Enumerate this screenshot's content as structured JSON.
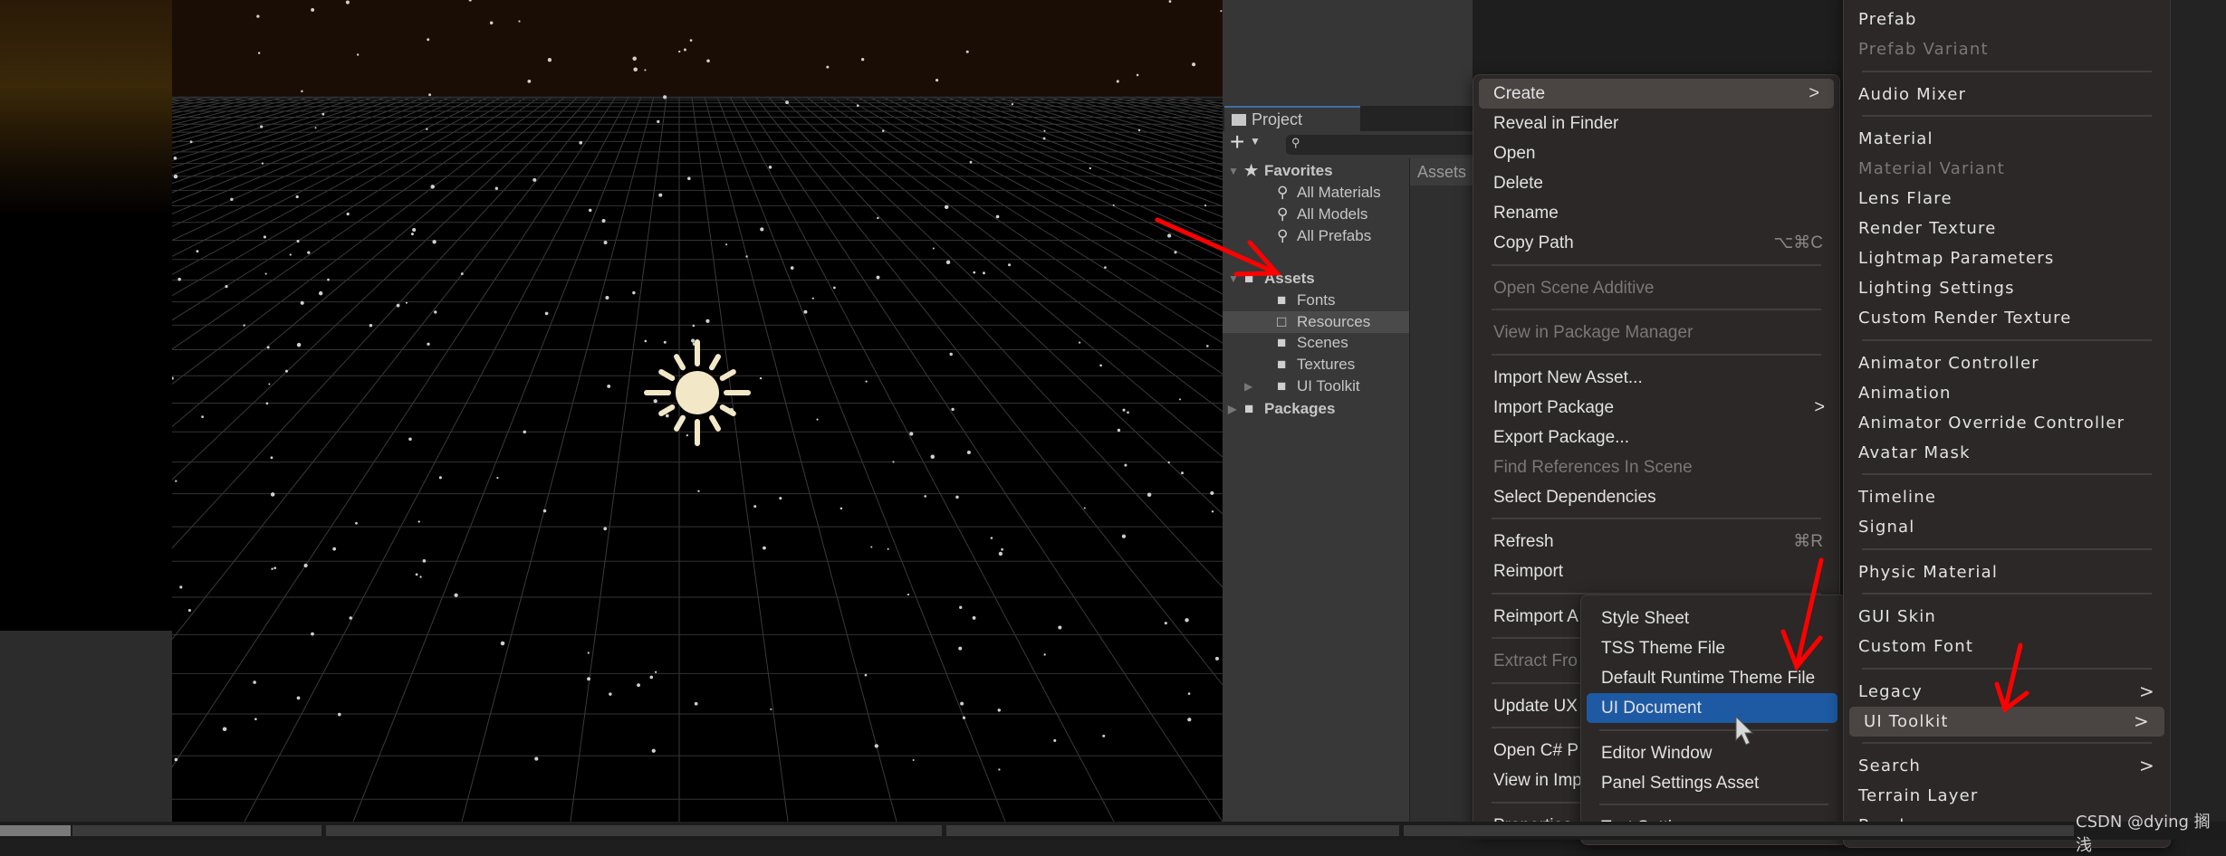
{
  "project_panel": {
    "tab_label": "Project",
    "add_button": "+",
    "assets_header": "Assets",
    "tree": [
      {
        "label": "Favorites",
        "icon": "star-icon",
        "level": 0,
        "bold": true,
        "expanded": true
      },
      {
        "label": "All Materials",
        "icon": "search-icon",
        "level": 1
      },
      {
        "label": "All Models",
        "icon": "search-icon",
        "level": 1
      },
      {
        "label": "All Prefabs",
        "icon": "search-icon",
        "level": 1
      },
      {
        "label": "Assets",
        "icon": "folder-open-icon",
        "level": 0,
        "bold": true,
        "expanded": true
      },
      {
        "label": "Fonts",
        "icon": "folder-icon",
        "level": 1
      },
      {
        "label": "Resources",
        "icon": "folder-outline-icon",
        "level": 1,
        "selected": true
      },
      {
        "label": "Scenes",
        "icon": "folder-icon",
        "level": 1
      },
      {
        "label": "Textures",
        "icon": "folder-icon",
        "level": 1
      },
      {
        "label": "UI Toolkit",
        "icon": "folder-icon",
        "level": 1,
        "collapsed": true
      },
      {
        "label": "Packages",
        "icon": "folder-icon",
        "level": 0,
        "bold": true,
        "collapsed": true
      }
    ]
  },
  "context_menu": {
    "items": [
      {
        "label": "Create",
        "submenu": true,
        "highlighted": true,
        "row": 0
      },
      {
        "label": "Reveal in Finder",
        "row": 1
      },
      {
        "label": "Open",
        "row": 2
      },
      {
        "label": "Delete",
        "row": 3
      },
      {
        "label": "Rename",
        "row": 4
      },
      {
        "label": "Copy Path",
        "shortcut": "⌥⌘C",
        "row": 5
      },
      {
        "sep": true,
        "row": 5.75
      },
      {
        "label": "Open Scene Additive",
        "disabled": true,
        "row": 6.5
      },
      {
        "sep": true,
        "row": 7.25
      },
      {
        "label": "View in Package Manager",
        "disabled": true,
        "row": 8
      },
      {
        "sep": true,
        "row": 8.75
      },
      {
        "label": "Import New Asset...",
        "row": 9.5
      },
      {
        "label": "Import Package",
        "submenu": true,
        "row": 10.5
      },
      {
        "label": "Export Package...",
        "row": 11.5
      },
      {
        "label": "Find References In Scene",
        "disabled": true,
        "row": 12.5
      },
      {
        "label": "Select Dependencies",
        "row": 13.5
      },
      {
        "sep": true,
        "row": 14.25
      },
      {
        "label": "Refresh",
        "shortcut": "⌘R",
        "row": 15
      },
      {
        "label": "Reimport",
        "row": 16
      },
      {
        "sep": true,
        "row": 16.75
      },
      {
        "label": "Reimport A",
        "row": 17.5
      },
      {
        "sep": true,
        "row": 18.25
      },
      {
        "label": "Extract Fro",
        "disabled": true,
        "row": 19
      },
      {
        "sep": true,
        "row": 19.75
      },
      {
        "label": "Update UX",
        "row": 20.5
      },
      {
        "sep": true,
        "row": 21.25
      },
      {
        "label": "Open C# P",
        "row": 22
      },
      {
        "label": "View in Imp",
        "row": 23
      },
      {
        "sep": true,
        "row": 23.75
      },
      {
        "label": "Properties.",
        "row": 24.5
      }
    ]
  },
  "uitoolkit_submenu": {
    "items": [
      {
        "label": "Style Sheet",
        "row": 0
      },
      {
        "label": "TSS Theme File",
        "row": 1
      },
      {
        "label": "Default Runtime Theme File",
        "row": 2
      },
      {
        "label": "UI Document",
        "selected": true,
        "row": 3
      },
      {
        "sep": true,
        "row": 3.75
      },
      {
        "label": "Editor Window",
        "row": 4.5
      },
      {
        "label": "Panel Settings Asset",
        "row": 5.5
      },
      {
        "sep": true,
        "row": 6.25
      },
      {
        "label": "Text Settings",
        "row": 7
      }
    ]
  },
  "create_submenu": {
    "items": [
      {
        "label": "Prefab",
        "row": 0
      },
      {
        "label": "Prefab Variant",
        "disabled": true,
        "row": 1
      },
      {
        "sep": true,
        "row": 1.75
      },
      {
        "label": "Audio Mixer",
        "row": 2.5
      },
      {
        "sep": true,
        "row": 3.25
      },
      {
        "label": "Material",
        "row": 4
      },
      {
        "label": "Material Variant",
        "disabled": true,
        "row": 5
      },
      {
        "label": "Lens Flare",
        "row": 6
      },
      {
        "label": "Render Texture",
        "row": 7
      },
      {
        "label": "Lightmap Parameters",
        "row": 8
      },
      {
        "label": "Lighting Settings",
        "row": 9
      },
      {
        "label": "Custom Render Texture",
        "row": 10
      },
      {
        "sep": true,
        "row": 10.75
      },
      {
        "label": "Animator Controller",
        "row": 11.5
      },
      {
        "label": "Animation",
        "row": 12.5
      },
      {
        "label": "Animator Override Controller",
        "row": 13.5
      },
      {
        "label": "Avatar Mask",
        "row": 14.5
      },
      {
        "sep": true,
        "row": 15.25
      },
      {
        "label": "Timeline",
        "row": 16
      },
      {
        "label": "Signal",
        "row": 17
      },
      {
        "sep": true,
        "row": 17.75
      },
      {
        "label": "Physic Material",
        "row": 18.5
      },
      {
        "sep": true,
        "row": 19.25
      },
      {
        "label": "GUI Skin",
        "row": 20
      },
      {
        "label": "Custom Font",
        "row": 21
      },
      {
        "sep": true,
        "row": 21.75
      },
      {
        "label": "Legacy",
        "submenu": true,
        "row": 22.5
      },
      {
        "label": "UI Toolkit",
        "submenu": true,
        "highlighted": true,
        "row": 23.5
      },
      {
        "sep": true,
        "row": 24.25
      },
      {
        "label": "Search",
        "submenu": true,
        "row": 25
      },
      {
        "label": "Terrain Layer",
        "row": 26
      },
      {
        "label": "Brush",
        "row": 27
      }
    ]
  },
  "watermark": "CSDN @dying 搁浅",
  "colors": {
    "selection_blue": "#1d5aa3",
    "annotation_red": "#ff0000",
    "menu_bg": "#2b2827"
  }
}
